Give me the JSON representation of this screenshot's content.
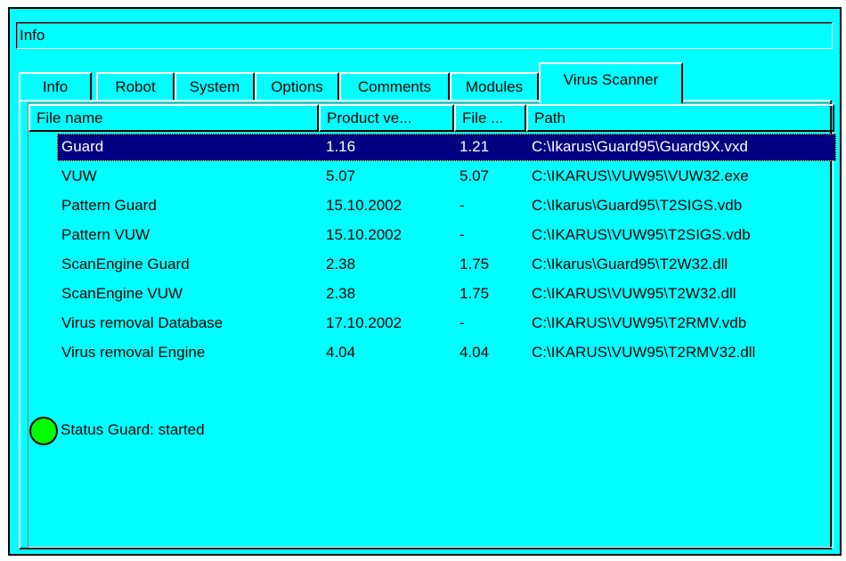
{
  "info_field": {
    "value": "Info"
  },
  "tabs": [
    {
      "label": "Info"
    },
    {
      "label": "Robot"
    },
    {
      "label": "System"
    },
    {
      "label": "Options"
    },
    {
      "label": "Comments"
    },
    {
      "label": "Modules"
    },
    {
      "label": "Virus Scanner",
      "active": true
    }
  ],
  "list": {
    "columns": [
      "File name",
      "Product ve...",
      "File ...",
      "Path"
    ],
    "rows": [
      {
        "name": "Guard",
        "product": "1.16",
        "file": "1.21",
        "path": "C:\\Ikarus\\Guard95\\Guard9X.vxd",
        "selected": true
      },
      {
        "name": "VUW",
        "product": "5.07",
        "file": "5.07",
        "path": "C:\\IKARUS\\VUW95\\VUW32.exe"
      },
      {
        "name": "Pattern Guard",
        "product": "15.10.2002",
        "file": "-",
        "path": "C:\\Ikarus\\Guard95\\T2SIGS.vdb"
      },
      {
        "name": "Pattern VUW",
        "product": "15.10.2002",
        "file": "-",
        "path": "C:\\IKARUS\\VUW95\\T2SIGS.vdb"
      },
      {
        "name": "ScanEngine Guard",
        "product": "2.38",
        "file": "1.75",
        "path": "C:\\Ikarus\\Guard95\\T2W32.dll"
      },
      {
        "name": "ScanEngine VUW",
        "product": "2.38",
        "file": "1.75",
        "path": "C:\\IKARUS\\VUW95\\T2W32.dll"
      },
      {
        "name": "Virus removal Database",
        "product": "17.10.2002",
        "file": "-",
        "path": "C:\\IKARUS\\VUW95\\T2RMV.vdb"
      },
      {
        "name": "Virus removal Engine",
        "product": "4.04",
        "file": "4.04",
        "path": "C:\\IKARUS\\VUW95\\T2RMV32.dll"
      }
    ]
  },
  "status": {
    "text": "Status Guard: started",
    "color": "#00ff00"
  },
  "colors": {
    "background": "#00ffff",
    "selection": "#000080"
  }
}
